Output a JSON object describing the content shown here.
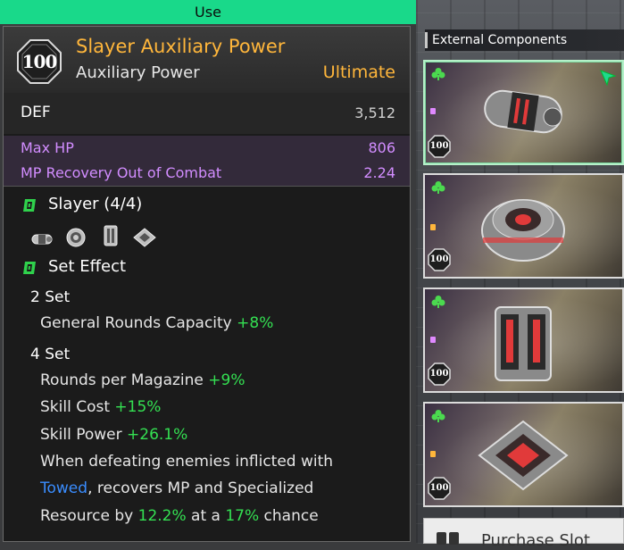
{
  "use_bar": {
    "label": "Use"
  },
  "item": {
    "level": "100",
    "name": "Slayer Auxiliary Power",
    "type": "Auxiliary Power",
    "grade": "Ultimate",
    "def_label": "DEF",
    "def_value": "3,512",
    "stats": [
      {
        "label": "Max HP",
        "value": "806"
      },
      {
        "label": "MP Recovery Out of Combat",
        "value": "2.24"
      }
    ]
  },
  "set": {
    "title": "Slayer (4/4)",
    "pieces": [
      "auxiliary-power-icon",
      "sensor-icon",
      "memory-icon",
      "processor-icon"
    ],
    "effect_title": "Set Effect",
    "two_set": {
      "label": "2 Set",
      "lines": [
        {
          "text": "General Rounds Capacity",
          "value": "+8%"
        }
      ]
    },
    "four_set": {
      "label": "4 Set",
      "lines": [
        {
          "text": "Rounds per Magazine",
          "value": "+9%"
        },
        {
          "text": "Skill Cost",
          "value": "+15%"
        },
        {
          "text": "Skill Power",
          "value": "+26.1%"
        }
      ],
      "desc": {
        "line1": "When defeating enemies inflicted with",
        "keyword": "Towed",
        "line2_rest": ", recovers MP and Specialized",
        "line3_a": "Resource by ",
        "value1": "12.2%",
        "line3_b": " at a ",
        "value2": "17%",
        "line3_c": " chance"
      }
    }
  },
  "right": {
    "section_title": "External Components",
    "cards": [
      {
        "name": "Auxiliary Power",
        "level": "100",
        "selected": true
      },
      {
        "name": "Sensor",
        "level": "100",
        "selected": false
      },
      {
        "name": "Memory",
        "level": "100",
        "selected": false
      },
      {
        "name": "Processor",
        "level": "100",
        "selected": false
      }
    ],
    "purchase_label": "Purchase Slot"
  },
  "colors": {
    "use_green": "#19d98a",
    "ultimate_gold": "#ffb63b",
    "stat_purple": "#d28dff",
    "bonus_green": "#34e052",
    "keyword_blue": "#3a8dff"
  }
}
